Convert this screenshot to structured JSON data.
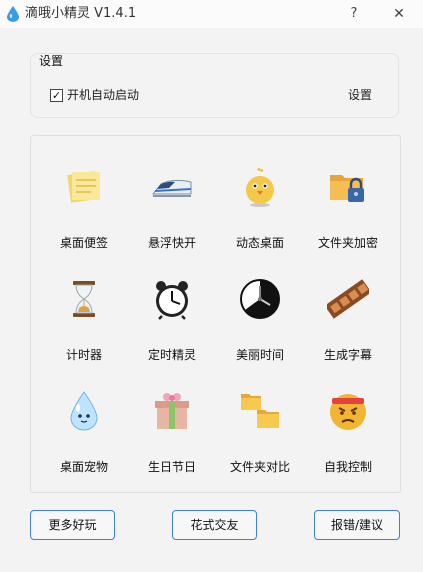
{
  "window": {
    "title": "滴哦小精灵 V1.4.1",
    "help": "?",
    "close": "✕"
  },
  "settings": {
    "group_title": "设置",
    "autostart_label": "开机自动启动",
    "autostart_checked": true,
    "check_mark": "✓",
    "settings_button": "设置"
  },
  "features": [
    {
      "label": "桌面便签",
      "icon": "sticky-note-icon"
    },
    {
      "label": "悬浮快开",
      "icon": "bullet-train-icon"
    },
    {
      "label": "动态桌面",
      "icon": "chick-icon"
    },
    {
      "label": "文件夹加密",
      "icon": "folder-lock-icon"
    },
    {
      "label": "计时器",
      "icon": "hourglass-icon"
    },
    {
      "label": "定时精灵",
      "icon": "alarm-clock-icon"
    },
    {
      "label": "美丽时间",
      "icon": "clock-face-icon"
    },
    {
      "label": "生成字幕",
      "icon": "film-strip-icon"
    },
    {
      "label": "桌面宠物",
      "icon": "water-drop-icon"
    },
    {
      "label": "生日节日",
      "icon": "gift-box-icon"
    },
    {
      "label": "文件夹对比",
      "icon": "folders-compare-icon"
    },
    {
      "label": "自我控制",
      "icon": "angry-face-icon"
    }
  ],
  "bottom_buttons": {
    "more_fun": "更多好玩",
    "make_friends": "花式交友",
    "feedback": "报错/建议"
  },
  "colors": {
    "accent_border": "#3f7fd6",
    "background": "#f3f3f3"
  }
}
